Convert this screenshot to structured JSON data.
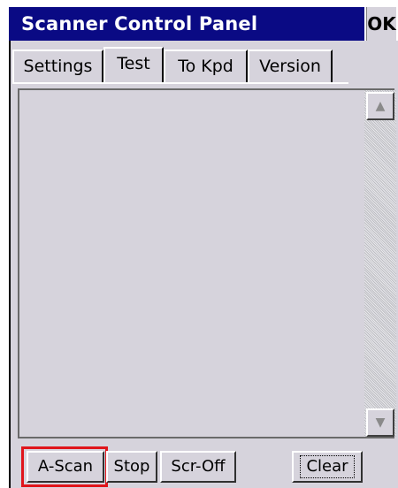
{
  "window": {
    "title": "Scanner Control Panel",
    "ok_label": "OK"
  },
  "tabs": [
    {
      "label": "Settings",
      "active": false
    },
    {
      "label": "Test",
      "active": true
    },
    {
      "label": "To Kpd",
      "active": false
    },
    {
      "label": "Version",
      "active": false
    }
  ],
  "scrollbar": {
    "up_icon": "up-arrow-icon",
    "down_icon": "down-arrow-icon"
  },
  "buttons": {
    "ascan_label": "A-Scan",
    "stop_label": "Stop",
    "scroff_label": "Scr-Off",
    "clear_label": "Clear"
  },
  "colors": {
    "titlebar": "#0a0a84",
    "panel": "#d6d3dc",
    "highlight": "#e0151b"
  }
}
